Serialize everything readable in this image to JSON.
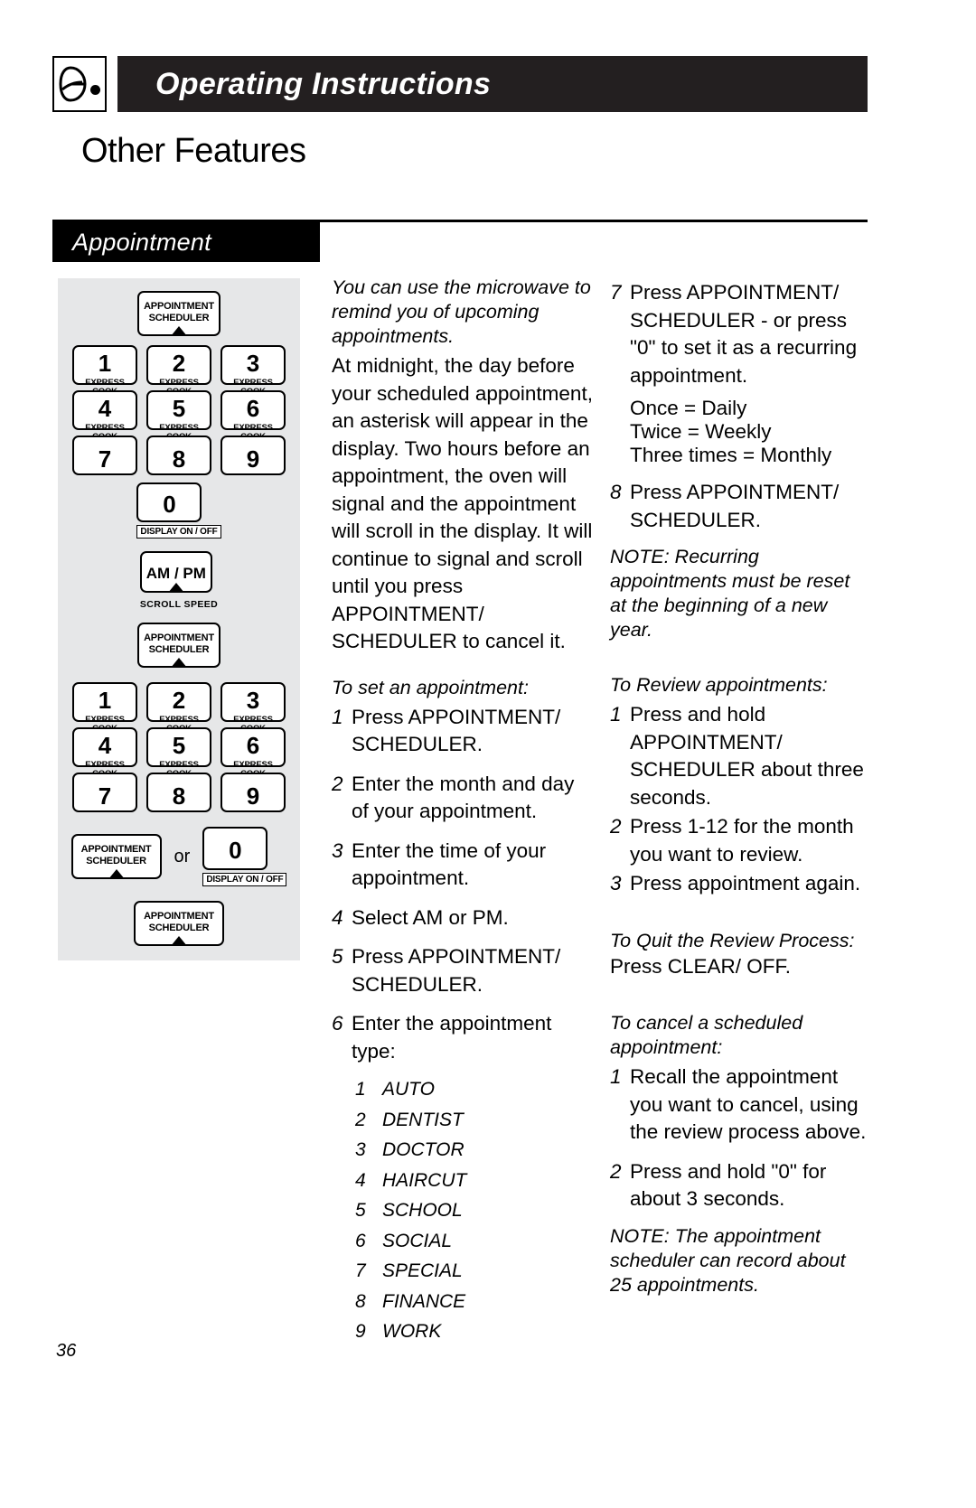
{
  "header": {
    "title": "Operating Instructions",
    "logo_name": "ge-logo"
  },
  "page_heading": "Other Features",
  "section": {
    "label": "Appointment"
  },
  "page_number": "36",
  "artwork": {
    "caption_top_key": {
      "line1": "APPOINTMENT",
      "line2": "SCHEDULER"
    },
    "keypad_rows": [
      [
        {
          "digit": "1",
          "sub": "EXPRESS COOK"
        },
        {
          "digit": "2",
          "sub": "EXPRESS COOK"
        },
        {
          "digit": "3",
          "sub": "EXPRESS COOK"
        }
      ],
      [
        {
          "digit": "4",
          "sub": "EXPRESS COOK"
        },
        {
          "digit": "5",
          "sub": "EXPRESS COOK"
        },
        {
          "digit": "6",
          "sub": "EXPRESS COOK"
        }
      ],
      [
        {
          "digit": "7",
          "sub": ""
        },
        {
          "digit": "8",
          "sub": ""
        },
        {
          "digit": "9",
          "sub": ""
        }
      ]
    ],
    "zero_key": {
      "digit": "0",
      "label": "DISPLAY ON / OFF"
    },
    "ampm_key": {
      "label": "AM / PM",
      "sub": "SCROLL SPEED"
    },
    "or_word": "or",
    "sched_key": {
      "line1": "APPOINTMENT",
      "line2": "SCHEDULER"
    }
  },
  "middle_column": {
    "intro_italic": "You can use the microwave to remind you of upcoming appointments.",
    "intro_body": "At midnight, the day before your scheduled appointment, an asterisk will appear in the display. Two hours before an appointment, the oven will signal and the appointment will scroll in the display. It will continue to signal and scroll until you press APPOINTMENT/ SCHEDULER to cancel it.",
    "set_heading": "To set an appointment:",
    "set_steps": [
      {
        "num": "1",
        "text": "Press APPOINTMENT/ SCHEDULER."
      },
      {
        "num": "2",
        "text": "Enter the month and day of your appointment."
      },
      {
        "num": "3",
        "text": "Enter the time of your appointment."
      },
      {
        "num": "4",
        "text": "Select AM or PM."
      },
      {
        "num": "5",
        "text": "Press APPOINTMENT/ SCHEDULER."
      },
      {
        "num": "6",
        "text": "Enter the appointment type:"
      }
    ],
    "appointment_types": [
      {
        "num": "1",
        "name": "AUTO"
      },
      {
        "num": "2",
        "name": "DENTIST"
      },
      {
        "num": "3",
        "name": "DOCTOR"
      },
      {
        "num": "4",
        "name": "HAIRCUT"
      },
      {
        "num": "5",
        "name": "SCHOOL"
      },
      {
        "num": "6",
        "name": "SOCIAL"
      },
      {
        "num": "7",
        "name": "SPECIAL"
      },
      {
        "num": "8",
        "name": "FINANCE"
      },
      {
        "num": "9",
        "name": "WORK"
      }
    ]
  },
  "right_column": {
    "step7": {
      "num": "7",
      "text": "Press APPOINTMENT/ SCHEDULER - or press \"0\" to set it as a recurring appointment."
    },
    "recurrence": [
      "Once  =  Daily",
      "Twice  =  Weekly",
      "Three times  =  Monthly"
    ],
    "step8": {
      "num": "8",
      "text": "Press APPOINTMENT/ SCHEDULER."
    },
    "note_recurring": "NOTE: Recurring appointments must be reset at the beginning of a new year.",
    "review_heading": "To Review appointments:",
    "review_steps": [
      {
        "num": "1",
        "text": "Press and hold APPOINTMENT/ SCHEDULER about three seconds."
      },
      {
        "num": "2",
        "text": "Press 1-12 for the month you want to review."
      },
      {
        "num": "3",
        "text": "Press appointment again."
      }
    ],
    "quit_heading": "To Quit the Review Process:",
    "quit_body": "Press CLEAR/ OFF.",
    "cancel_heading": "To cancel a scheduled appointment:",
    "cancel_steps": [
      {
        "num": "1",
        "text": "Recall the appointment you want to cancel, using the review process above."
      },
      {
        "num": "2",
        "text": "Press and hold \"0\" for about 3 seconds."
      }
    ],
    "note_capacity": "NOTE: The appointment scheduler can record about 25 appointments."
  }
}
